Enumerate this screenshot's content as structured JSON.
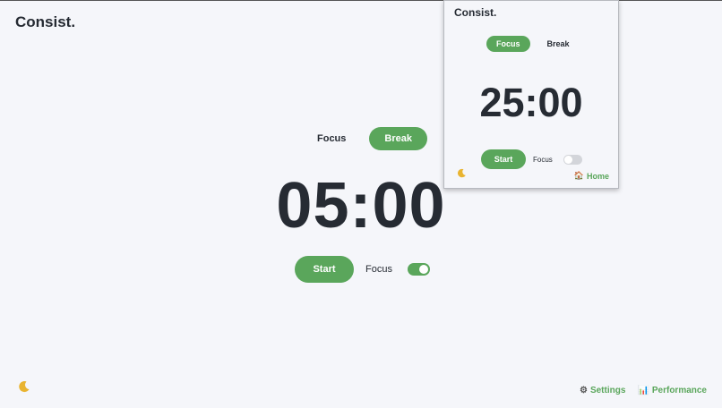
{
  "app": {
    "brand": "Consist."
  },
  "main": {
    "modes": [
      {
        "label": "Focus",
        "active": false
      },
      {
        "label": "Break",
        "active": true
      }
    ],
    "timer": "05:00",
    "start_label": "Start",
    "focus_label": "Focus",
    "focus_toggle": "on",
    "theme_icon": "moon-icon"
  },
  "footer": {
    "settings": {
      "icon": "gear-icon",
      "glyph": "⚙",
      "label": "Settings"
    },
    "performance": {
      "icon": "bar-chart-icon",
      "glyph": "📊",
      "label": "Performance"
    }
  },
  "popup": {
    "brand": "Consist.",
    "modes": [
      {
        "label": "Focus",
        "active": true
      },
      {
        "label": "Break",
        "active": false
      }
    ],
    "timer": "25:00",
    "start_label": "Start",
    "focus_label": "Focus",
    "focus_toggle": "off",
    "theme_icon": "moon-icon",
    "home": {
      "icon": "home-icon",
      "glyph": "🏠",
      "label": "Home"
    }
  },
  "colors": {
    "accent": "#5aa65b",
    "text": "#262b33",
    "background": "#f5f6fa",
    "moon": "#e9b431"
  }
}
